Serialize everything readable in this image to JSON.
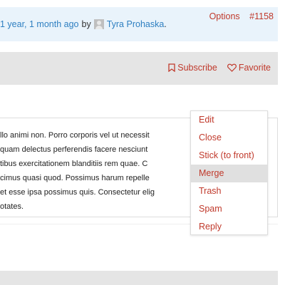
{
  "notice": {
    "time_link": "1 year, 1 month ago",
    "by": "by",
    "author": "Tyra Prohaska",
    "period": "."
  },
  "header": {
    "subscribe_label": "Subscribe",
    "favorite_label": "Favorite"
  },
  "topic": {
    "options_label": "Options",
    "id_label": "#1158",
    "lines": [
      "llo animi non. Porro corporis vel ut necessit",
      "quam delectus perferendis facere nesciunt",
      "tibus exercitationem blanditiis rem quae. C",
      "cimus quasi quod. Possimus harum repelle",
      "et esse ipsa possimus quis. Consectetur elig",
      "otates."
    ]
  },
  "menu": {
    "items": [
      "Edit",
      "Close",
      "Stick (to front)",
      "Merge",
      "Trash",
      "Spam",
      "Reply"
    ],
    "hovered_item": "Merge"
  },
  "colors": {
    "accent": "#c0392b",
    "link": "#2e7fc1",
    "notice_bg": "#e9f3fb",
    "bar_bg": "#e5e5e5"
  }
}
